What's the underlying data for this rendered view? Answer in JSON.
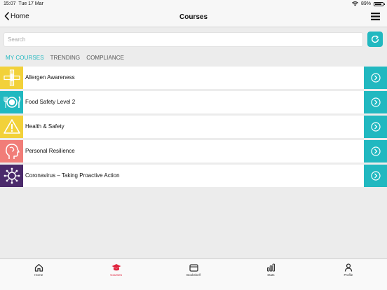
{
  "status": {
    "time": "15:07",
    "date": "Tue 17 Mar",
    "battery": "89%",
    "battery_level": 0.89
  },
  "nav": {
    "back_label": "Home",
    "title": "Courses"
  },
  "search": {
    "placeholder": "Search",
    "value": ""
  },
  "tabs": [
    {
      "label": "MY COURSES",
      "active": true
    },
    {
      "label": "TRENDING",
      "active": false
    },
    {
      "label": "COMPLIANCE",
      "active": false
    }
  ],
  "courses": [
    {
      "title": "Allergen Awareness",
      "icon": "allergen-icon",
      "color": "#f2d13a"
    },
    {
      "title": "Food Safety Level 2",
      "icon": "plate-cutlery-icon",
      "color": "#21b8c0"
    },
    {
      "title": "Health & Safety",
      "icon": "warning-icon",
      "color": "#f2d13a"
    },
    {
      "title": "Personal Resilience",
      "icon": "head-profile-icon",
      "color": "#f17d78"
    },
    {
      "title": "Coronavirus – Taking Proactive Action",
      "icon": "virus-icon",
      "color": "#4b2a6b"
    }
  ],
  "tab_bar": [
    {
      "label": "Home",
      "icon": "home-icon",
      "active": false
    },
    {
      "label": "Courses",
      "icon": "graduation-cap-icon",
      "active": true
    },
    {
      "label": "Bookshelf",
      "icon": "bookshelf-icon",
      "active": false
    },
    {
      "label": "Stats",
      "icon": "stats-icon",
      "active": false
    },
    {
      "label": "Profile",
      "icon": "profile-icon",
      "active": false
    }
  ],
  "colors": {
    "accent": "#21b8c0",
    "active_tab_bar": "#e0243e"
  }
}
